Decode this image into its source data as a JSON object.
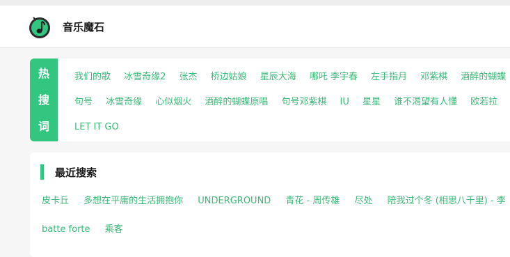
{
  "app": {
    "title": "音乐魔石",
    "logo_icon": "music-note-icon",
    "accent_color": "#33c680"
  },
  "hot_search": {
    "label_chars": [
      "热",
      "搜",
      "词"
    ],
    "items": [
      "我们的歌",
      "冰雪奇缘2",
      "张杰",
      "桥边姑娘",
      "星辰大海",
      "哪吒 李宇春",
      "左手指月",
      "邓紫棋",
      "酒醉的蝴蝶",
      "句号",
      "冰雪奇缘",
      "心似烟火",
      "酒醉的蝴蝶原唱",
      "句号邓紫棋",
      "IU",
      "星星",
      "谁不渴望有人懂",
      "欧若拉",
      "LET IT GO"
    ]
  },
  "recent_search": {
    "title": "最近搜索",
    "items": [
      "皮卡丘",
      "多想在平庸的生活拥抱你",
      "UNDERGROUND",
      "青花 - 周传雄",
      "尽处",
      "陪我过个冬 (相思八千里) - 李",
      "batte forte",
      "乘客"
    ]
  }
}
